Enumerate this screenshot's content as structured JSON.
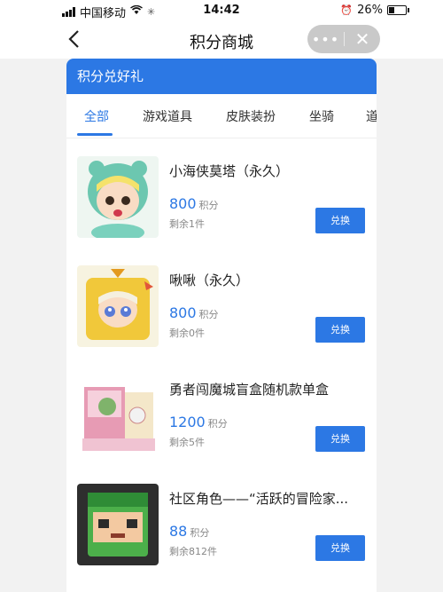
{
  "status_bar": {
    "carrier": "中国移动",
    "time": "14:42",
    "battery": "26%"
  },
  "nav": {
    "title": "积分商城",
    "more": "•••",
    "close": "✕"
  },
  "card": {
    "header": "积分兑好礼"
  },
  "tabs": [
    {
      "label": "全部",
      "active": true
    },
    {
      "label": "游戏道具"
    },
    {
      "label": "皮肤装扮"
    },
    {
      "label": "坐骑"
    },
    {
      "label": "道"
    }
  ],
  "unit_label": "积分",
  "redeem_label": "兑换",
  "items": [
    {
      "name": "小海侠莫塔（永久）",
      "points": "800",
      "stock": "剩余1件",
      "icon": "mermaid-avatar-icon"
    },
    {
      "name": "啾啾（永久）",
      "points": "800",
      "stock": "剩余0件",
      "icon": "chick-avatar-icon"
    },
    {
      "name": "勇者闯魔城盲盒随机款单盒",
      "points": "1200",
      "stock": "剩余5件",
      "icon": "blind-box-icon"
    },
    {
      "name": "社区角色——“活跃的冒险家...",
      "points": "88",
      "stock": "剩余812件",
      "icon": "adventurer-avatar-icon"
    }
  ],
  "colors": {
    "accent": "#2c78e4",
    "page_bg": "#f2f2f2",
    "muted_text": "#888888"
  }
}
